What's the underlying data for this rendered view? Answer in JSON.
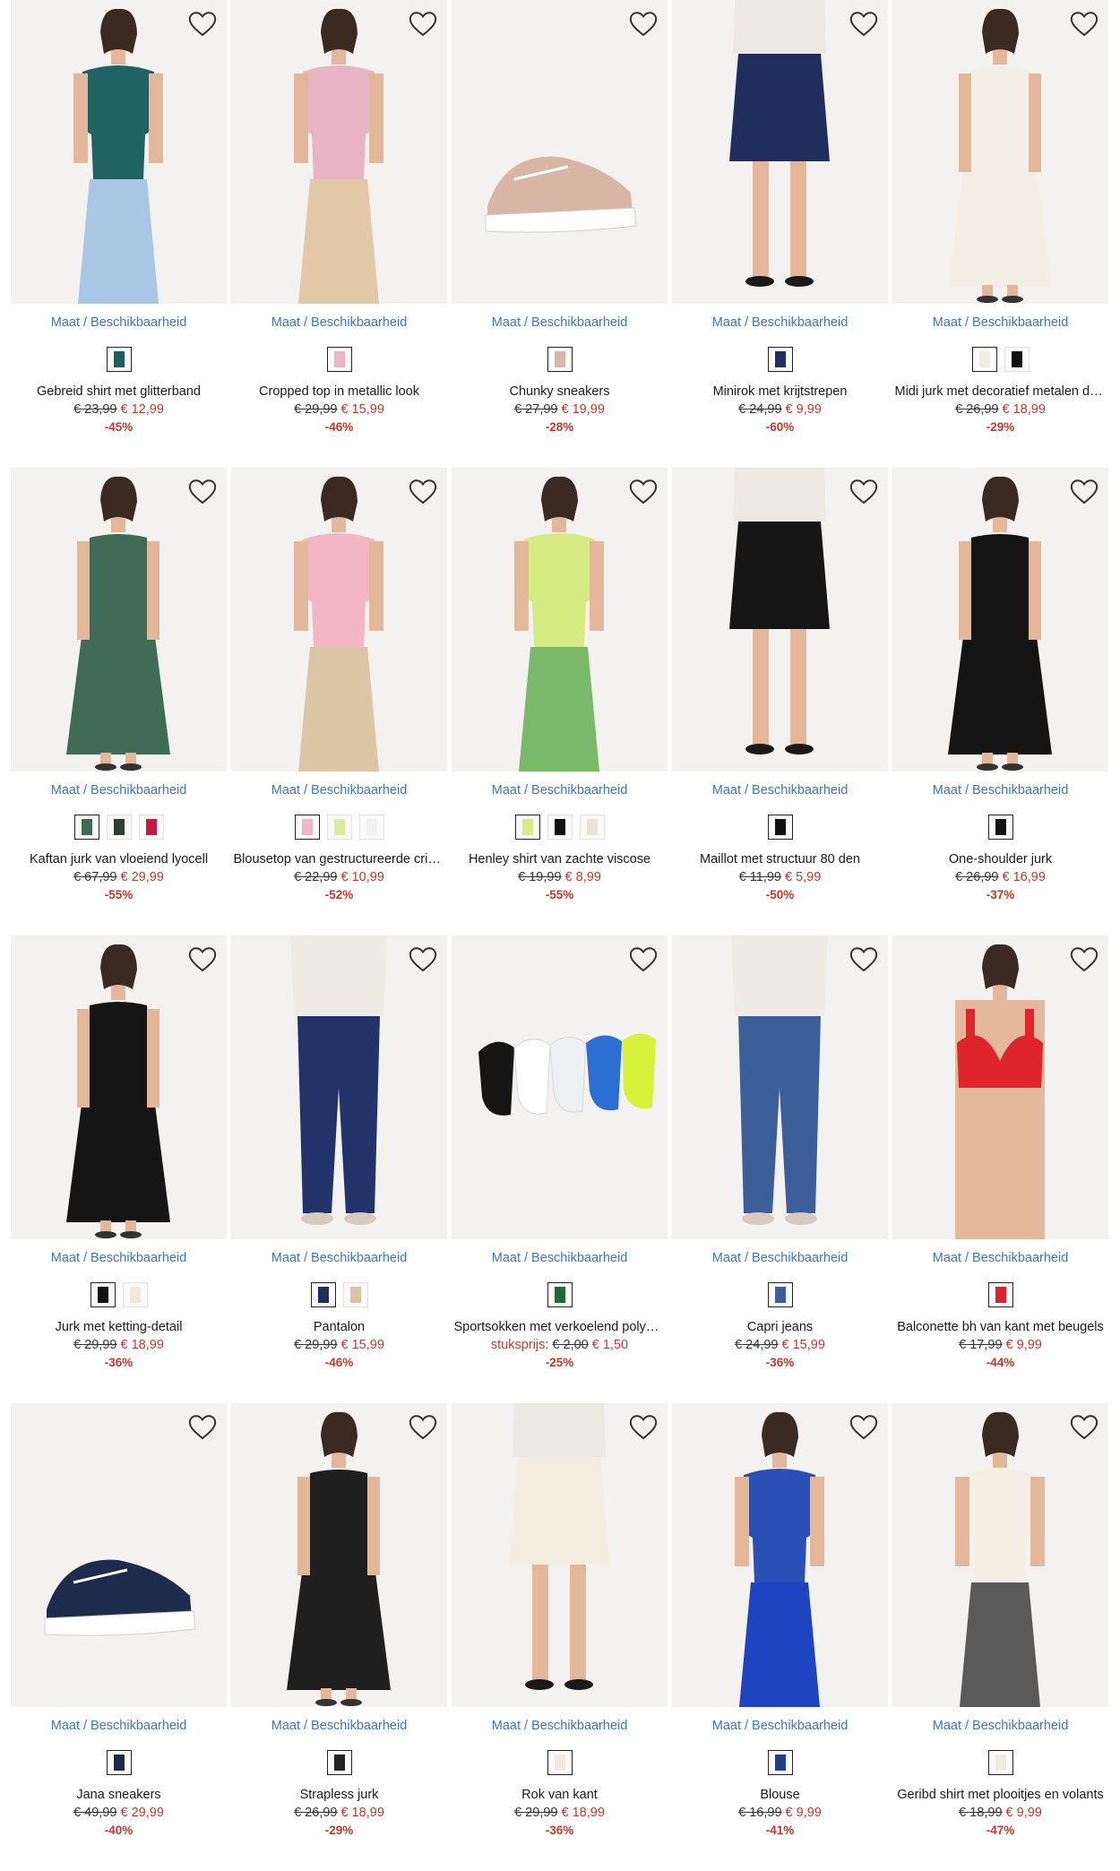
{
  "colors": {
    "link": "#3a78b8",
    "sale": "#c0392b",
    "text": "#1a1a1a",
    "photo_bg": "#f3f2f0"
  },
  "availability_label": "Maat / Beschikbaarheid",
  "favorite_icon": "heart-outline-icon",
  "products": [
    {
      "name": "Gebreid shirt met glitterband",
      "unit_label": "",
      "old_price": "€ 23,99",
      "new_price": "€ 12,99",
      "discount": "-45%",
      "swatches": [
        "#1e5f5c"
      ],
      "image": {
        "kind": "top",
        "main": "#1f6462",
        "bottom": "#a9c6e4"
      }
    },
    {
      "name": "Cropped top in metallic look",
      "unit_label": "",
      "old_price": "€ 29,99",
      "new_price": "€ 15,99",
      "discount": "-46%",
      "swatches": [
        "#e7b7c9"
      ],
      "image": {
        "kind": "top",
        "main": "#e8b4c6",
        "bottom": "#e3c8a8"
      }
    },
    {
      "name": "Chunky sneakers",
      "unit_label": "",
      "old_price": "€ 27,99",
      "new_price": "€ 19,99",
      "discount": "-28%",
      "swatches": [
        "#d8b7a8"
      ],
      "image": {
        "kind": "shoe",
        "main": "#d9b5a3",
        "bottom": "#ffffff"
      }
    },
    {
      "name": "Minirok met krijtstrepen",
      "unit_label": "",
      "old_price": "€ 24,99",
      "new_price": "€ 9,99",
      "discount": "-60%",
      "swatches": [
        "#1f2e5c"
      ],
      "image": {
        "kind": "skirt",
        "main": "#1f2e5c",
        "bottom": "#f1efeb"
      }
    },
    {
      "name": "Midi jurk met decoratief metalen detail",
      "unit_label": "",
      "old_price": "€ 26,99",
      "new_price": "€ 18,99",
      "discount": "-29%",
      "swatches": [
        "#f2ede2",
        "#111111"
      ],
      "image": {
        "kind": "dress",
        "main": "#f4efe4",
        "bottom": "#f4efe4"
      }
    },
    {
      "name": "Kaftan jurk van vloeiend lyocell",
      "unit_label": "",
      "old_price": "€ 67,99",
      "new_price": "€ 29,99",
      "discount": "-55%",
      "swatches": [
        "#3f6a55",
        "#2b3f33",
        "#c4194a"
      ],
      "image": {
        "kind": "dress",
        "main": "#406b57",
        "bottom": "#406b57"
      }
    },
    {
      "name": "Blousetop van gestructureerde crinkle",
      "unit_label": "",
      "old_price": "€ 22,99",
      "new_price": "€ 10,99",
      "discount": "-52%",
      "swatches": [
        "#f0b8c6",
        "#d8ec9c",
        "#f1f1f1"
      ],
      "image": {
        "kind": "top",
        "main": "#f2b6c4",
        "bottom": "#dcc6a4"
      }
    },
    {
      "name": "Henley shirt van zachte viscose",
      "unit_label": "",
      "old_price": "€ 19,99",
      "new_price": "€ 8,99",
      "discount": "-55%",
      "swatches": [
        "#d8ec86",
        "#111111",
        "#eae2d2"
      ],
      "image": {
        "kind": "top",
        "main": "#d6ec82",
        "bottom": "#7ab86a"
      }
    },
    {
      "name": "Maillot met structuur 80 den",
      "unit_label": "",
      "old_price": "€ 11,99",
      "new_price": "€ 5,99",
      "discount": "-50%",
      "swatches": [
        "#111111"
      ],
      "image": {
        "kind": "skirt",
        "main": "#161616",
        "bottom": "#111111"
      }
    },
    {
      "name": "One-shoulder jurk",
      "unit_label": "",
      "old_price": "€ 26,99",
      "new_price": "€ 16,99",
      "discount": "-37%",
      "swatches": [
        "#111111"
      ],
      "image": {
        "kind": "dress",
        "main": "#141414",
        "bottom": "#141414"
      }
    },
    {
      "name": "Jurk met ketting-detail",
      "unit_label": "",
      "old_price": "€ 29,99",
      "new_price": "€ 18,99",
      "discount": "-36%",
      "swatches": [
        "#111111",
        "#f1ead8"
      ],
      "image": {
        "kind": "dress",
        "main": "#151515",
        "bottom": "#151515"
      }
    },
    {
      "name": "Pantalon",
      "unit_label": "",
      "old_price": "€ 29,99",
      "new_price": "€ 15,99",
      "discount": "-46%",
      "swatches": [
        "#1f2e5c",
        "#d9c3a0"
      ],
      "image": {
        "kind": "pants",
        "main": "#22336a",
        "bottom": "#22336a"
      }
    },
    {
      "name": "Sportsokken met verkoelend polyester",
      "unit_label": "stuksprijs:",
      "old_price": "€ 2,00",
      "new_price": "€ 1,50",
      "discount": "-25%",
      "swatches": [
        "#1f6a3c"
      ],
      "image": {
        "kind": "socks",
        "main": "#2a6fd1",
        "bottom": "#d7f23b"
      }
    },
    {
      "name": "Capri jeans",
      "unit_label": "",
      "old_price": "€ 24,99",
      "new_price": "€ 15,99",
      "discount": "-36%",
      "swatches": [
        "#3d5f97"
      ],
      "image": {
        "kind": "pants",
        "main": "#3c5f99",
        "bottom": "#3c5f99"
      }
    },
    {
      "name": "Balconette bh van kant met beugels",
      "unit_label": "",
      "old_price": "€ 17,99",
      "new_price": "€ 9,99",
      "discount": "-44%",
      "swatches": [
        "#d4252c"
      ],
      "image": {
        "kind": "bra",
        "main": "#e0242b",
        "bottom": "#f3e6dc"
      }
    },
    {
      "name": "Jana sneakers",
      "unit_label": "",
      "old_price": "€ 49,99",
      "new_price": "€ 29,99",
      "discount": "-40%",
      "swatches": [
        "#1b2a4a"
      ],
      "image": {
        "kind": "shoe",
        "main": "#1d2b4d",
        "bottom": "#ffffff"
      }
    },
    {
      "name": "Strapless jurk",
      "unit_label": "",
      "old_price": "€ 26,99",
      "new_price": "€ 18,99",
      "discount": "-29%",
      "swatches": [
        "#222222"
      ],
      "image": {
        "kind": "dress",
        "main": "#1f1f1f",
        "bottom": "#e8e8e8"
      }
    },
    {
      "name": "Rok van kant",
      "unit_label": "",
      "old_price": "€ 29,99",
      "new_price": "€ 18,99",
      "discount": "-36%",
      "swatches": [
        "#f3eadc"
      ],
      "image": {
        "kind": "skirt",
        "main": "#f5eee0",
        "bottom": "#eadfd0"
      }
    },
    {
      "name": "Blouse",
      "unit_label": "",
      "old_price": "€ 16,99",
      "new_price": "€ 9,99",
      "discount": "-41%",
      "swatches": [
        "#1f3f8f"
      ],
      "image": {
        "kind": "top",
        "main": "#2a4fb5",
        "bottom": "#1f44c2"
      }
    },
    {
      "name": "Geribd shirt met plooitjes en volants",
      "unit_label": "",
      "old_price": "€ 18,99",
      "new_price": "€ 9,99",
      "discount": "-47%",
      "swatches": [
        "#f1ecdd"
      ],
      "image": {
        "kind": "top",
        "main": "#f4efe2",
        "bottom": "#5a5a5a"
      }
    }
  ]
}
